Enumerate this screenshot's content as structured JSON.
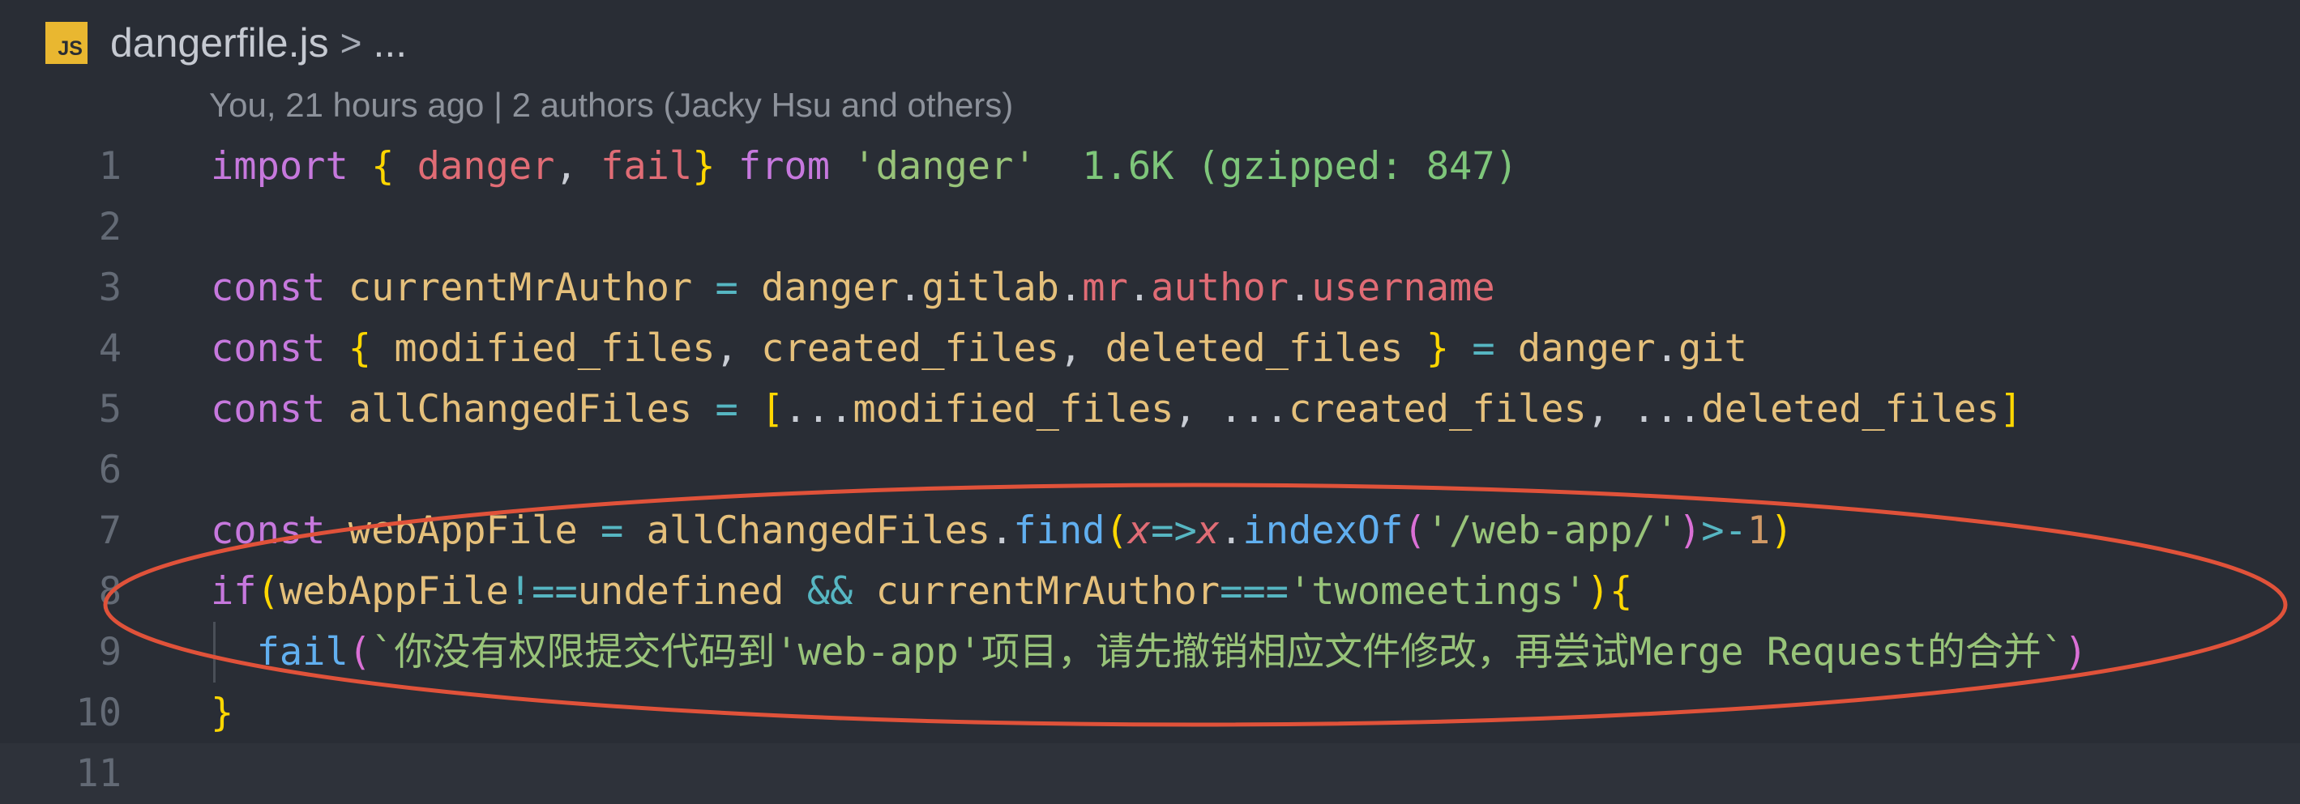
{
  "breadcrumb": {
    "icon_label": "JS",
    "file": "dangerfile.js",
    "separator": ">",
    "more": "..."
  },
  "blame": "You, 21 hours ago | 2 authors (Jacky Hsu and others)",
  "lines": [
    {
      "n": "1",
      "t": [
        {
          "c": "kw",
          "v": "import"
        },
        {
          "c": "plain",
          "v": " "
        },
        {
          "c": "br",
          "v": "{"
        },
        {
          "c": "plain",
          "v": " "
        },
        {
          "c": "prop",
          "v": "danger"
        },
        {
          "c": "plain",
          "v": ", "
        },
        {
          "c": "prop",
          "v": "fail"
        },
        {
          "c": "br",
          "v": "}"
        },
        {
          "c": "plain",
          "v": " "
        },
        {
          "c": "kw",
          "v": "from"
        },
        {
          "c": "plain",
          "v": " "
        },
        {
          "c": "str",
          "v": "'danger'"
        },
        {
          "c": "plain",
          "v": "  "
        },
        {
          "c": "size",
          "v": "1.6K (gzipped: 847)"
        }
      ]
    },
    {
      "n": "2",
      "t": []
    },
    {
      "n": "3",
      "t": [
        {
          "c": "kw",
          "v": "const"
        },
        {
          "c": "plain",
          "v": " "
        },
        {
          "c": "var",
          "v": "currentMrAuthor"
        },
        {
          "c": "plain",
          "v": " "
        },
        {
          "c": "op",
          "v": "="
        },
        {
          "c": "plain",
          "v": " "
        },
        {
          "c": "var",
          "v": "danger"
        },
        {
          "c": "plain",
          "v": "."
        },
        {
          "c": "var",
          "v": "gitlab"
        },
        {
          "c": "plain",
          "v": "."
        },
        {
          "c": "prop",
          "v": "mr"
        },
        {
          "c": "plain",
          "v": "."
        },
        {
          "c": "prop",
          "v": "author"
        },
        {
          "c": "plain",
          "v": "."
        },
        {
          "c": "prop",
          "v": "username"
        }
      ]
    },
    {
      "n": "4",
      "t": [
        {
          "c": "kw",
          "v": "const"
        },
        {
          "c": "plain",
          "v": " "
        },
        {
          "c": "br",
          "v": "{"
        },
        {
          "c": "plain",
          "v": " "
        },
        {
          "c": "var",
          "v": "modified_files"
        },
        {
          "c": "plain",
          "v": ", "
        },
        {
          "c": "var",
          "v": "created_files"
        },
        {
          "c": "plain",
          "v": ", "
        },
        {
          "c": "var",
          "v": "deleted_files"
        },
        {
          "c": "plain",
          "v": " "
        },
        {
          "c": "br",
          "v": "}"
        },
        {
          "c": "plain",
          "v": " "
        },
        {
          "c": "op",
          "v": "="
        },
        {
          "c": "plain",
          "v": " "
        },
        {
          "c": "var",
          "v": "danger"
        },
        {
          "c": "plain",
          "v": "."
        },
        {
          "c": "var",
          "v": "git"
        }
      ]
    },
    {
      "n": "5",
      "t": [
        {
          "c": "kw",
          "v": "const"
        },
        {
          "c": "plain",
          "v": " "
        },
        {
          "c": "var",
          "v": "allChangedFiles"
        },
        {
          "c": "plain",
          "v": " "
        },
        {
          "c": "op",
          "v": "="
        },
        {
          "c": "plain",
          "v": " "
        },
        {
          "c": "br",
          "v": "["
        },
        {
          "c": "plain",
          "v": "..."
        },
        {
          "c": "var",
          "v": "modified_files"
        },
        {
          "c": "plain",
          "v": ", ..."
        },
        {
          "c": "var",
          "v": "created_files"
        },
        {
          "c": "plain",
          "v": ", ..."
        },
        {
          "c": "var",
          "v": "deleted_files"
        },
        {
          "c": "br",
          "v": "]"
        }
      ]
    },
    {
      "n": "6",
      "t": []
    },
    {
      "n": "7",
      "t": [
        {
          "c": "kw",
          "v": "const"
        },
        {
          "c": "plain",
          "v": " "
        },
        {
          "c": "var",
          "v": "webAppFile"
        },
        {
          "c": "plain",
          "v": " "
        },
        {
          "c": "op",
          "v": "="
        },
        {
          "c": "plain",
          "v": " "
        },
        {
          "c": "var",
          "v": "allChangedFiles"
        },
        {
          "c": "plain",
          "v": "."
        },
        {
          "c": "fn",
          "v": "find"
        },
        {
          "c": "br",
          "v": "("
        },
        {
          "c": "param",
          "v": "x"
        },
        {
          "c": "op",
          "v": "=>"
        },
        {
          "c": "param",
          "v": "x"
        },
        {
          "c": "plain",
          "v": "."
        },
        {
          "c": "fn",
          "v": "indexOf"
        },
        {
          "c": "br2",
          "v": "("
        },
        {
          "c": "str",
          "v": "'/web-app/'"
        },
        {
          "c": "br2",
          "v": ")"
        },
        {
          "c": "op",
          "v": ">-"
        },
        {
          "c": "num",
          "v": "1"
        },
        {
          "c": "br",
          "v": ")"
        }
      ]
    },
    {
      "n": "8",
      "t": [
        {
          "c": "kw",
          "v": "if"
        },
        {
          "c": "br",
          "v": "("
        },
        {
          "c": "var",
          "v": "webAppFile"
        },
        {
          "c": "op",
          "v": "!=="
        },
        {
          "c": "var",
          "v": "undefined"
        },
        {
          "c": "plain",
          "v": " "
        },
        {
          "c": "op",
          "v": "&&"
        },
        {
          "c": "plain",
          "v": " "
        },
        {
          "c": "var",
          "v": "currentMrAuthor"
        },
        {
          "c": "op",
          "v": "==="
        },
        {
          "c": "str",
          "v": "'twomeetings'"
        },
        {
          "c": "br",
          "v": ")"
        },
        {
          "c": "br",
          "v": "{"
        }
      ]
    },
    {
      "n": "9",
      "guide": true,
      "t": [
        {
          "c": "plain",
          "v": "  "
        },
        {
          "c": "fn",
          "v": "fail"
        },
        {
          "c": "br2",
          "v": "("
        },
        {
          "c": "str",
          "v": "`你没有权限提交代码到'web-app'项目，请先撤销相应文件修改，再尝试Merge Request的合并`"
        },
        {
          "c": "br2",
          "v": ")"
        }
      ]
    },
    {
      "n": "10",
      "t": [
        {
          "c": "br",
          "v": "}"
        }
      ]
    },
    {
      "n": "11",
      "active": true,
      "t": []
    }
  ],
  "colors": {
    "background": "#292d35",
    "annotation_ellipse": "#e0523a"
  }
}
